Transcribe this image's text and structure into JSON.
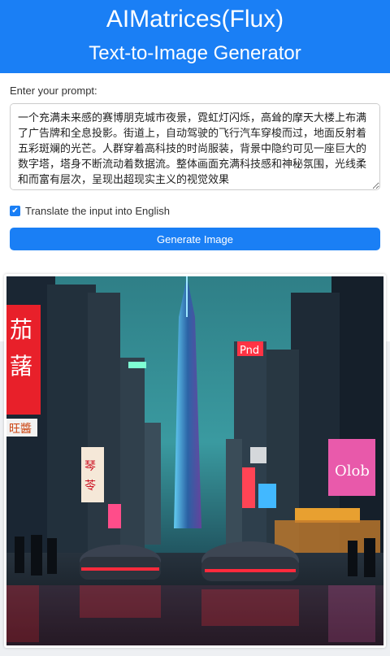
{
  "header": {
    "title": "AIMatrices(Flux)",
    "subtitle": "Text-to-Image Generator"
  },
  "form": {
    "prompt_label": "Enter your prompt:",
    "prompt_value": "一个充满未来感的赛博朋克城市夜景，霓虹灯闪烁，高耸的摩天大楼上布满了广告牌和全息投影。街道上，自动驾驶的飞行汽车穿梭而过，地面反射着五彩斑斓的光芒。人群穿着高科技的时尚服装，背景中隐约可见一座巨大的数字塔，塔身不断流动着数据流。整体画面充满科技感和神秘氛围，光线柔和而富有层次，呈现出超现实主义的视觉效果",
    "translate_label": "Translate the input into English",
    "translate_checked": true,
    "generate_label": "Generate Image"
  },
  "colors": {
    "accent": "#1a7ff5"
  }
}
